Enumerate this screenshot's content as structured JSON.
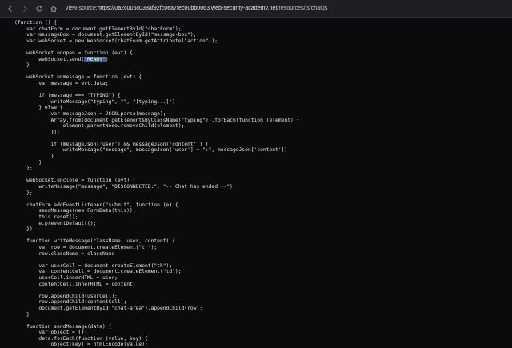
{
  "browser": {
    "back_icon": "back-arrow-icon",
    "forward_icon": "forward-arrow-icon",
    "reload_icon": "reload-icon",
    "home_icon": "home-icon",
    "url_scheme": "view-source:",
    "url_host": "https://0a2c006c038af92fc0ea7fec00bb0063.web-security-academy.net",
    "url_path": "/resources/js/chat.js"
  },
  "source": {
    "highlight_text": "\"READY\"",
    "lines": [
      "(function () {",
      "    var chatForm = document.getElementById(\"chatForm\");",
      "    var messageBox = document.getElementById(\"message-box\");",
      "    var webSocket = new WebSocket(chatForm.getAttribute(\"action\"));",
      "",
      "    webSocket.onopen = function (evt) {",
      "        webSocket.send(\"READY\")",
      "    }",
      "",
      "    webSocket.onmessage = function (evt) {",
      "        var message = evt.data;",
      "",
      "        if (message === \"TYPING\") {",
      "            writeMessage(\"typing\", \"\", \"[typing...]\")",
      "        } else {",
      "            var messageJson = JSON.parse(message);",
      "            Array.from(document.getElementsByClassName(\"typing\")).forEach(function (element) {",
      "                element.parentNode.removeChild(element);",
      "            });",
      "",
      "            if (messageJson['user'] && messageJson['content']) {",
      "                writeMessage(\"message\", messageJson['user'] + \":\", messageJson['content'])",
      "            }",
      "        }",
      "    };",
      "",
      "    webSocket.onclose = function (evt) {",
      "        writeMessage(\"message\", \"DISCONNECTED:\", \"-- Chat has ended --\")",
      "    };",
      "",
      "    chatForm.addEventListener(\"submit\", function (e) {",
      "        sendMessage(new FormData(this));",
      "        this.reset();",
      "        e.preventDefault();",
      "    });",
      "",
      "    function writeMessage(className, user, content) {",
      "        var row = document.createElement(\"tr\");",
      "        row.className = className",
      "",
      "        var userCell = document.createElement(\"th\");",
      "        var contentCell = document.createElement(\"td\");",
      "        userCell.innerHTML = user;",
      "        contentCell.innerHTML = content;",
      "",
      "        row.appendChild(userCell);",
      "        row.appendChild(contentCell);",
      "        document.getElementById(\"chat-area\").appendChild(row);",
      "    }",
      "",
      "    function sendMessage(data) {",
      "        var object = {};",
      "        data.forEach(function (value, key) {",
      "            object[key] = htmlEncode(value);"
    ]
  }
}
